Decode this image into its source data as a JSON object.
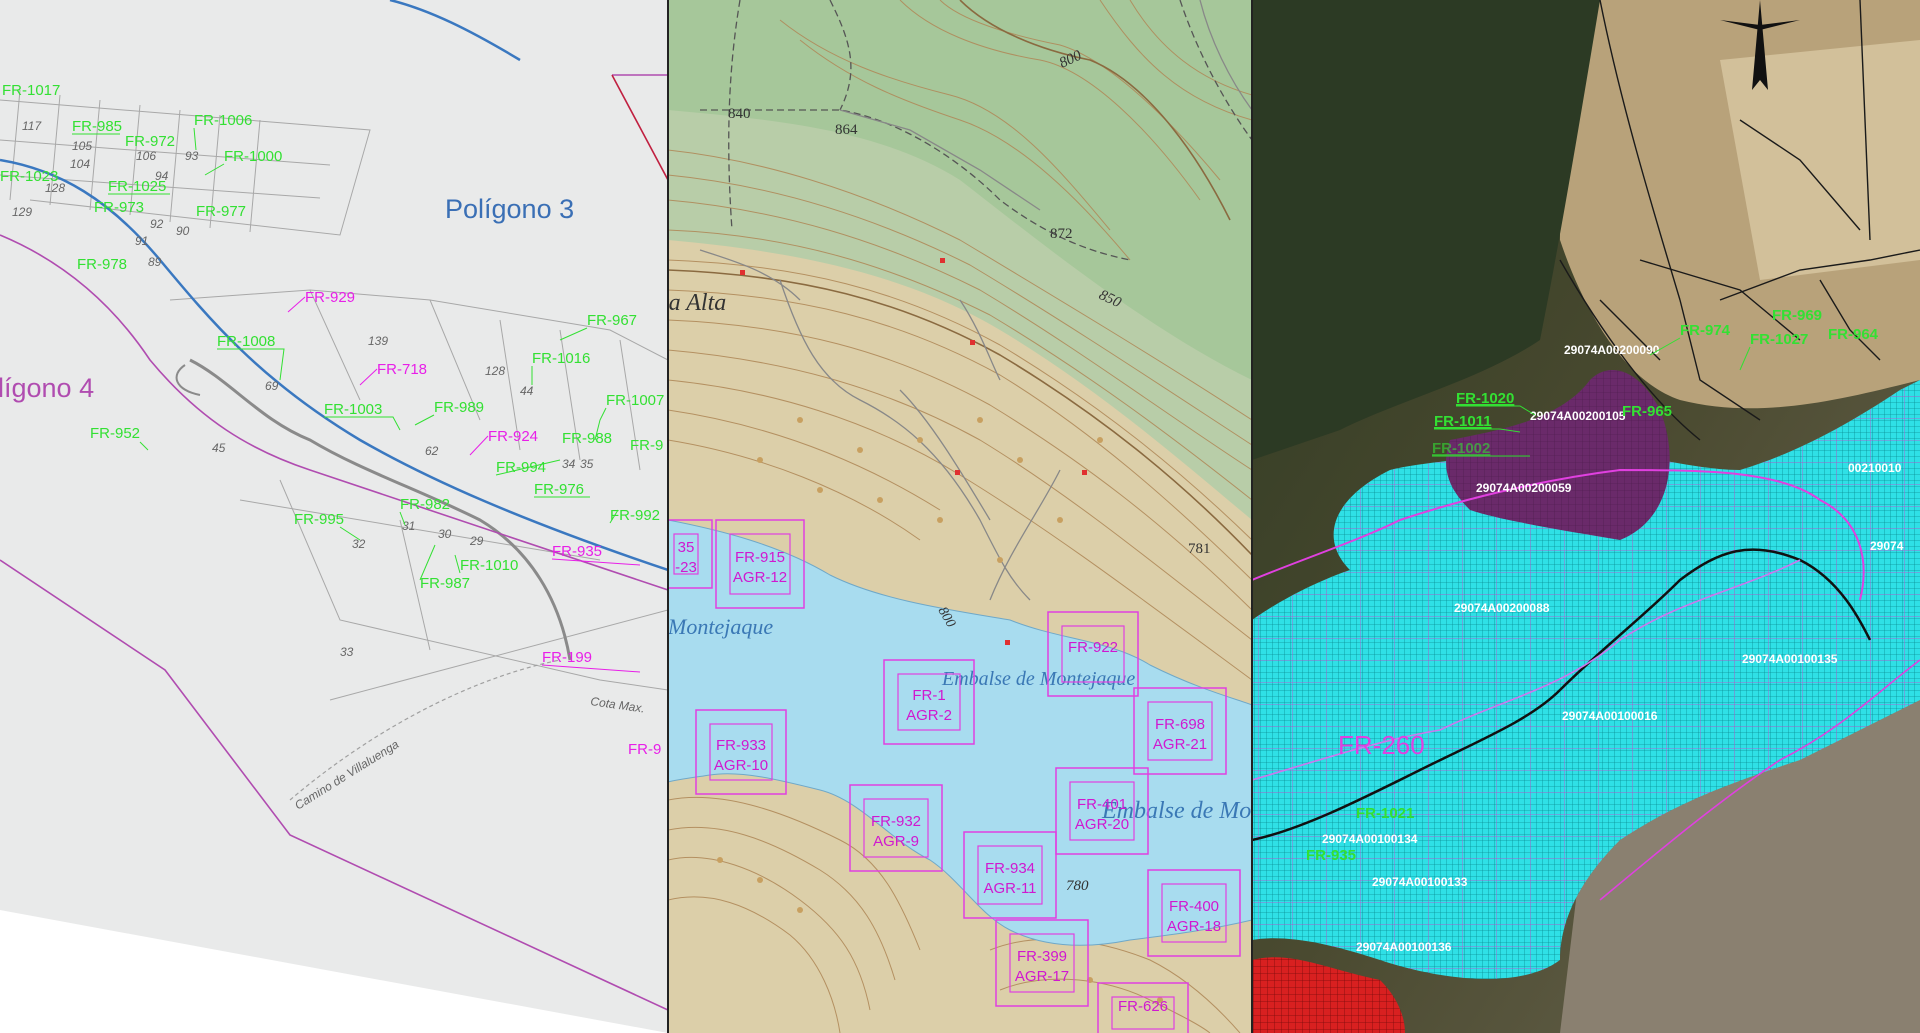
{
  "panel1": {
    "poligono3": "Polígono 3",
    "poligono4": "lígono 4",
    "labels_green": [
      "FR-1017",
      "FR-985",
      "FR-972",
      "FR-1006",
      "FR-1000",
      "FR-1023",
      "FR-1025",
      "FR-973",
      "FR-977",
      "FR-978",
      "FR-1008",
      "FR-967",
      "FR-1016",
      "FR-1003",
      "FR-989",
      "FR-1007",
      "FR-952",
      "FR-988",
      "FR-9",
      "FR-994",
      "FR-976",
      "FR-992",
      "FR-995",
      "FR-982",
      "FR-1010",
      "FR-987"
    ],
    "labels_magenta": [
      "FR-929",
      "FR-718",
      "FR-924",
      "FR-935",
      "FR-199",
      "FR-9"
    ],
    "parcel_numbers": [
      "117",
      "105",
      "106",
      "104",
      "128",
      "129",
      "93",
      "94",
      "92",
      "90",
      "91",
      "89",
      "139",
      "69",
      "128",
      "44",
      "62",
      "45",
      "30",
      "29",
      "31",
      "32",
      "33",
      "34",
      "35"
    ],
    "road_labels": [
      "Camino de Villaluenga",
      "Cota Max."
    ]
  },
  "panel2": {
    "place": "ta Alta",
    "reservoir_top": "Montejaque",
    "reservoir_mid": "Embalse de Montejaque",
    "reservoir_right": "Embalse de Montejaque",
    "elevations": [
      "840",
      "864",
      "872",
      "800",
      "850",
      "781",
      "780",
      "800"
    ],
    "boxes": [
      {
        "fr": "FR-915",
        "agr": "AGR-12"
      },
      {
        "fr": "FR-1",
        "agr": "AGR-2"
      },
      {
        "fr": "FR-933",
        "agr": "AGR-10"
      },
      {
        "fr": "FR-932",
        "agr": "AGR-9"
      },
      {
        "fr": "FR-934",
        "agr": "AGR-11"
      },
      {
        "fr": "FR-922",
        "agr": ""
      },
      {
        "fr": "FR-698",
        "agr": "AGR-21"
      },
      {
        "fr": "FR-401",
        "agr": "AGR-20"
      },
      {
        "fr": "FR-400",
        "agr": "AGR-18"
      },
      {
        "fr": "FR-399",
        "agr": "AGR-17"
      },
      {
        "fr": "FR-626",
        "agr": ""
      },
      {
        "fr": "35",
        "agr": "-23"
      }
    ]
  },
  "panel3": {
    "big_label": "FR-260",
    "refs": [
      "29074A00200090",
      "29074A00200105",
      "29074A00200059",
      "29074A00200088",
      "29074A00100135",
      "29074A00100016",
      "29074A00100134",
      "29074A00100133",
      "29074A00100136",
      "00210010",
      "29074"
    ],
    "labels_green": [
      "FR-1020",
      "FR-1011",
      "FR-1002",
      "FR-965",
      "FR-974",
      "FR-1027",
      "FR-964",
      "FR-969",
      "FR-1021",
      "FR-935"
    ]
  },
  "colors": {
    "green_label": "#33e033",
    "magenta_label": "#e81fe8",
    "cyan_zone": "#2fe0e6",
    "purple_zone": "#6a2a6a",
    "red_zone": "#d82020",
    "water": "#a8dcef"
  }
}
